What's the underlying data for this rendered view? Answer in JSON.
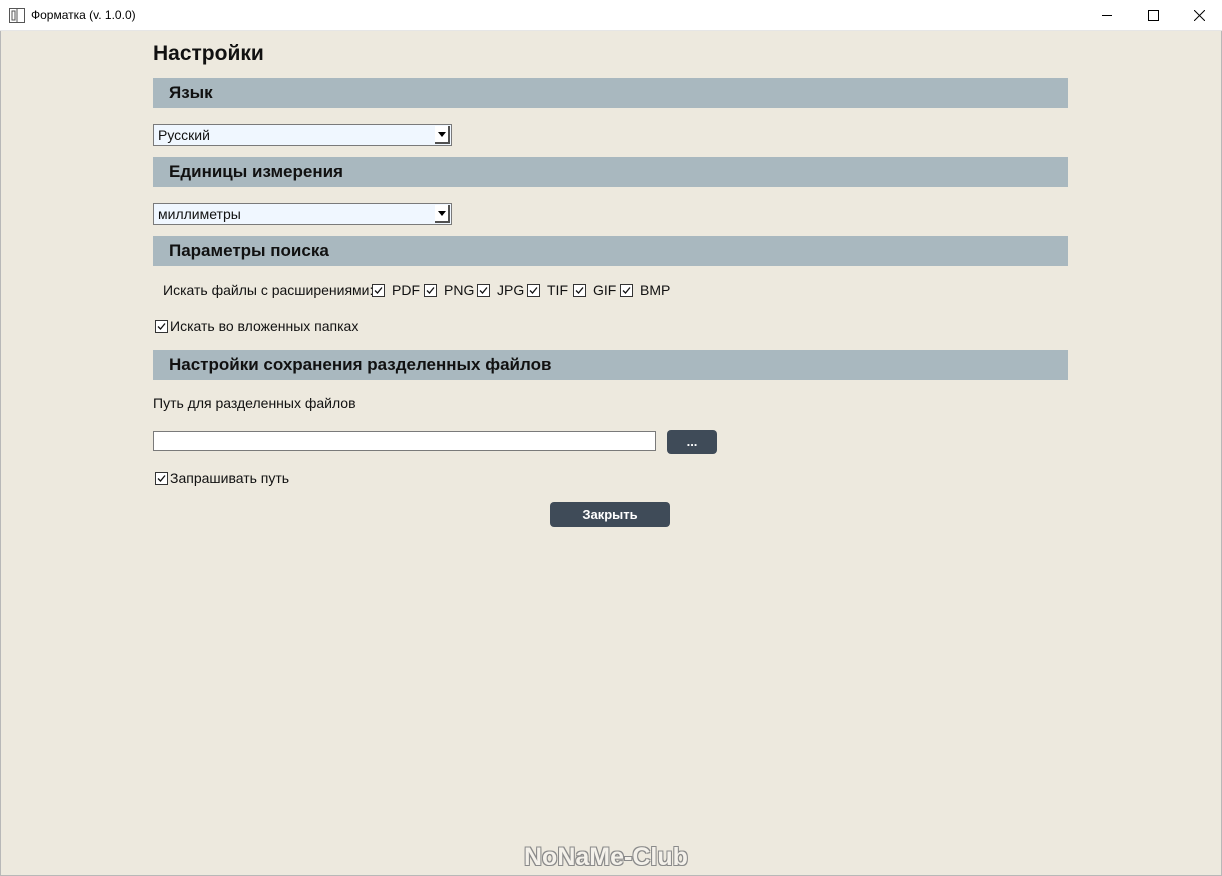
{
  "window": {
    "title": "Форматка (v. 1.0.0)"
  },
  "page": {
    "title": "Настройки"
  },
  "sections": {
    "language": {
      "header": "Язык",
      "selected": "Русский"
    },
    "units": {
      "header": "Единицы измерения",
      "selected": "миллиметры"
    },
    "search": {
      "header": "Параметры поиска",
      "extensions_label": "Искать файлы с расширениями:",
      "extensions": [
        {
          "label": "PDF",
          "checked": true
        },
        {
          "label": "PNG",
          "checked": true
        },
        {
          "label": "JPG",
          "checked": true
        },
        {
          "label": "TIF",
          "checked": true
        },
        {
          "label": "GIF",
          "checked": true
        },
        {
          "label": "BMP",
          "checked": true
        }
      ],
      "subfolders_label": "Искать во вложенных папках",
      "subfolders_checked": true
    },
    "save": {
      "header": "Настройки сохранения разделенных файлов",
      "path_label": "Путь для разделенных файлов",
      "path_value": "",
      "browse_label": "...",
      "ask_path_label": "Запрашивать путь",
      "ask_path_checked": true
    }
  },
  "close_button": "Закрыть",
  "watermark": "NoNaMe-Club",
  "icons": {
    "app": "window-split-icon",
    "minimize": "minimize-icon",
    "maximize": "maximize-icon",
    "close": "close-icon",
    "dropdown": "chevron-down-icon",
    "check": "check-icon"
  },
  "colors": {
    "background": "#ede9de",
    "section_header": "#a9b8bf",
    "button": "#3f4b58",
    "select_bg": "#f0f7ff"
  }
}
